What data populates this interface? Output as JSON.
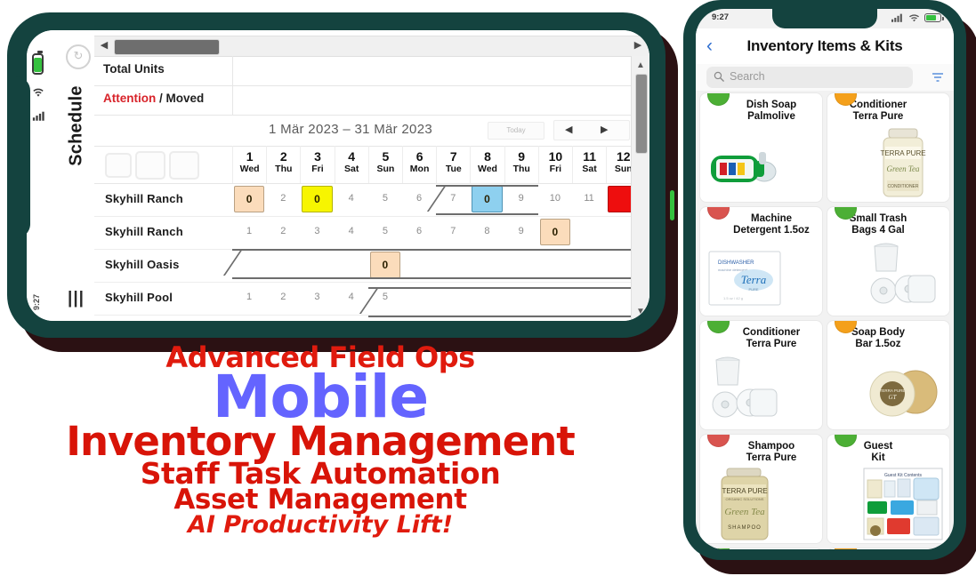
{
  "background_color": "#ffffff",
  "frame_color": "#14433f",
  "shadow_color": "#2b1113",
  "left_phone": {
    "orientation": "landscape",
    "status": {
      "time": "9:27",
      "battery_icon": "battery-icon",
      "wifi_icon": "wifi-icon",
      "signal_icon": "signal-icon"
    },
    "rail": {
      "title": "Schedule",
      "menu_icon": "menu-icon",
      "sync_icon": "sync-icon"
    },
    "scrollbars": {
      "h_left_arrow": "◀",
      "h_right_arrow": "▶",
      "v_up_arrow": "▲",
      "v_down_arrow": "▼"
    },
    "rows_header": {
      "total_units": "Total Units",
      "attention": "Attention",
      "attention_rest": " / Moved"
    },
    "date_range": "1 Mär 2023 – 31 Mär 2023",
    "today_button": "Today",
    "nav_prev": "◀",
    "nav_next": "▶",
    "toolbar_icons": [
      "list-view-icon",
      "grid-view-icon",
      "calendar-view-icon"
    ],
    "days": [
      {
        "num": "1",
        "dow": "Wed"
      },
      {
        "num": "2",
        "dow": "Thu"
      },
      {
        "num": "3",
        "dow": "Fri"
      },
      {
        "num": "4",
        "dow": "Sat"
      },
      {
        "num": "5",
        "dow": "Sun"
      },
      {
        "num": "6",
        "dow": "Mon"
      },
      {
        "num": "7",
        "dow": "Tue"
      },
      {
        "num": "8",
        "dow": "Wed"
      },
      {
        "num": "9",
        "dow": "Thu"
      },
      {
        "num": "10",
        "dow": "Fri"
      },
      {
        "num": "11",
        "dow": "Sat"
      },
      {
        "num": "12",
        "dow": "Sun"
      }
    ],
    "schedule_rows": [
      {
        "name": "Skyhill Ranch",
        "cells": [
          {
            "day": 1,
            "type": "chip",
            "color": "peach",
            "value": "0"
          },
          {
            "day": 2,
            "type": "number",
            "value": "2"
          },
          {
            "day": 3,
            "type": "chip",
            "color": "yellow",
            "value": "0"
          },
          {
            "day": 4,
            "type": "number",
            "value": "4"
          },
          {
            "day": 5,
            "type": "number",
            "value": "5"
          },
          {
            "day": 6,
            "type": "number",
            "value": "6"
          },
          {
            "day": 7,
            "type": "number",
            "value": "7"
          },
          {
            "day": 8,
            "type": "chip",
            "color": "blue",
            "value": "0"
          },
          {
            "day": 9,
            "type": "number",
            "value": "9"
          },
          {
            "day": 10,
            "type": "number",
            "value": "10"
          },
          {
            "day": 11,
            "type": "number",
            "value": "11"
          },
          {
            "day": 12,
            "type": "chip",
            "color": "red",
            "value": ""
          }
        ]
      },
      {
        "name": "Skyhill Ranch",
        "cells": [
          {
            "day": 1,
            "type": "number",
            "value": "1"
          },
          {
            "day": 2,
            "type": "number",
            "value": "2"
          },
          {
            "day": 3,
            "type": "number",
            "value": "3"
          },
          {
            "day": 4,
            "type": "number",
            "value": "4"
          },
          {
            "day": 5,
            "type": "number",
            "value": "5"
          },
          {
            "day": 6,
            "type": "number",
            "value": "6"
          },
          {
            "day": 7,
            "type": "number",
            "value": "7"
          },
          {
            "day": 8,
            "type": "number",
            "value": "8"
          },
          {
            "day": 9,
            "type": "number",
            "value": "9"
          },
          {
            "day": 10,
            "type": "chip",
            "color": "peach",
            "value": "0"
          }
        ]
      },
      {
        "name": "Skyhill Oasis",
        "cells": [
          {
            "day": 5,
            "type": "chip",
            "color": "peach",
            "value": "0"
          }
        ]
      },
      {
        "name": "Skyhill Pool",
        "cells": [
          {
            "day": 1,
            "type": "number",
            "value": "1"
          },
          {
            "day": 2,
            "type": "number",
            "value": "2"
          },
          {
            "day": 3,
            "type": "number",
            "value": "3"
          },
          {
            "day": 4,
            "type": "number",
            "value": "4"
          },
          {
            "day": 5,
            "type": "number",
            "value": "5"
          }
        ]
      }
    ]
  },
  "right_phone": {
    "orientation": "portrait",
    "status": {
      "time": "9:27",
      "signal_icon": "signal-icon",
      "wifi_icon": "wifi-icon",
      "battery_icon": "battery-icon"
    },
    "header": {
      "back_icon": "chevron-left-icon",
      "title": "Inventory Items & Kits"
    },
    "search": {
      "placeholder": "Search",
      "icon": "search-icon",
      "filter_icon": "filter-icon"
    },
    "items": [
      {
        "status": "green",
        "status_color": "#4caf35",
        "name": "Dish Soap\nPalmolive",
        "line1": "Dish Soap",
        "line2": "Palmolive",
        "image": "dish-soap-bottle"
      },
      {
        "status": "orange",
        "status_color": "#f4a01b",
        "name": "Conditioner\nTerra Pure",
        "line1": "Conditioner",
        "line2": "Terra Pure",
        "image": "conditioner-jar"
      },
      {
        "status": "red",
        "status_color": "#d9544f",
        "name": "Machine\nDetergent 1.5oz",
        "line1": "Machine",
        "line2": "Detergent 1.5oz",
        "image": "detergent-packet"
      },
      {
        "status": "green",
        "status_color": "#4caf35",
        "name": "Small Trash\nBags 4 Gal",
        "line1": "Small Trash",
        "line2": "Bags 4 Gal",
        "image": "trash-bag-rolls"
      },
      {
        "status": "green",
        "status_color": "#4caf35",
        "name": "Conditioner\nTerra Pure",
        "line1": "Conditioner",
        "line2": "Terra Pure",
        "image": "trash-bag-rolls"
      },
      {
        "status": "orange",
        "status_color": "#f4a01b",
        "name": "Soap Body\nBar 1.5oz",
        "line1": "Soap Body",
        "line2": "Bar 1.5oz",
        "image": "soap-bars"
      },
      {
        "status": "red",
        "status_color": "#d9544f",
        "name": "Shampoo\nTerra Pure",
        "line1": "Shampoo",
        "line2": "Terra Pure",
        "image": "shampoo-jar"
      },
      {
        "status": "green",
        "status_color": "#4caf35",
        "name": "Guest\nKit",
        "line1": "Guest",
        "line2": "Kit",
        "image": "guest-kit-poster"
      },
      {
        "status": "green",
        "status_color": "#4caf35",
        "name": "",
        "line1": "",
        "line2": "",
        "image": "",
        "partial": true
      },
      {
        "status": "orange",
        "status_color": "#f4a01b",
        "name": "",
        "line1": "",
        "line2": "",
        "image": "",
        "partial": true
      }
    ]
  },
  "promo": {
    "line1": "Advanced Field Ops",
    "line2": "Mobile",
    "line3": "Inventory Management",
    "line4": "Staff Task Automation",
    "line5": "Asset Management",
    "line6": "AI Productivity Lift!",
    "color_red": "#d81408",
    "color_blue": "#6464ff"
  }
}
